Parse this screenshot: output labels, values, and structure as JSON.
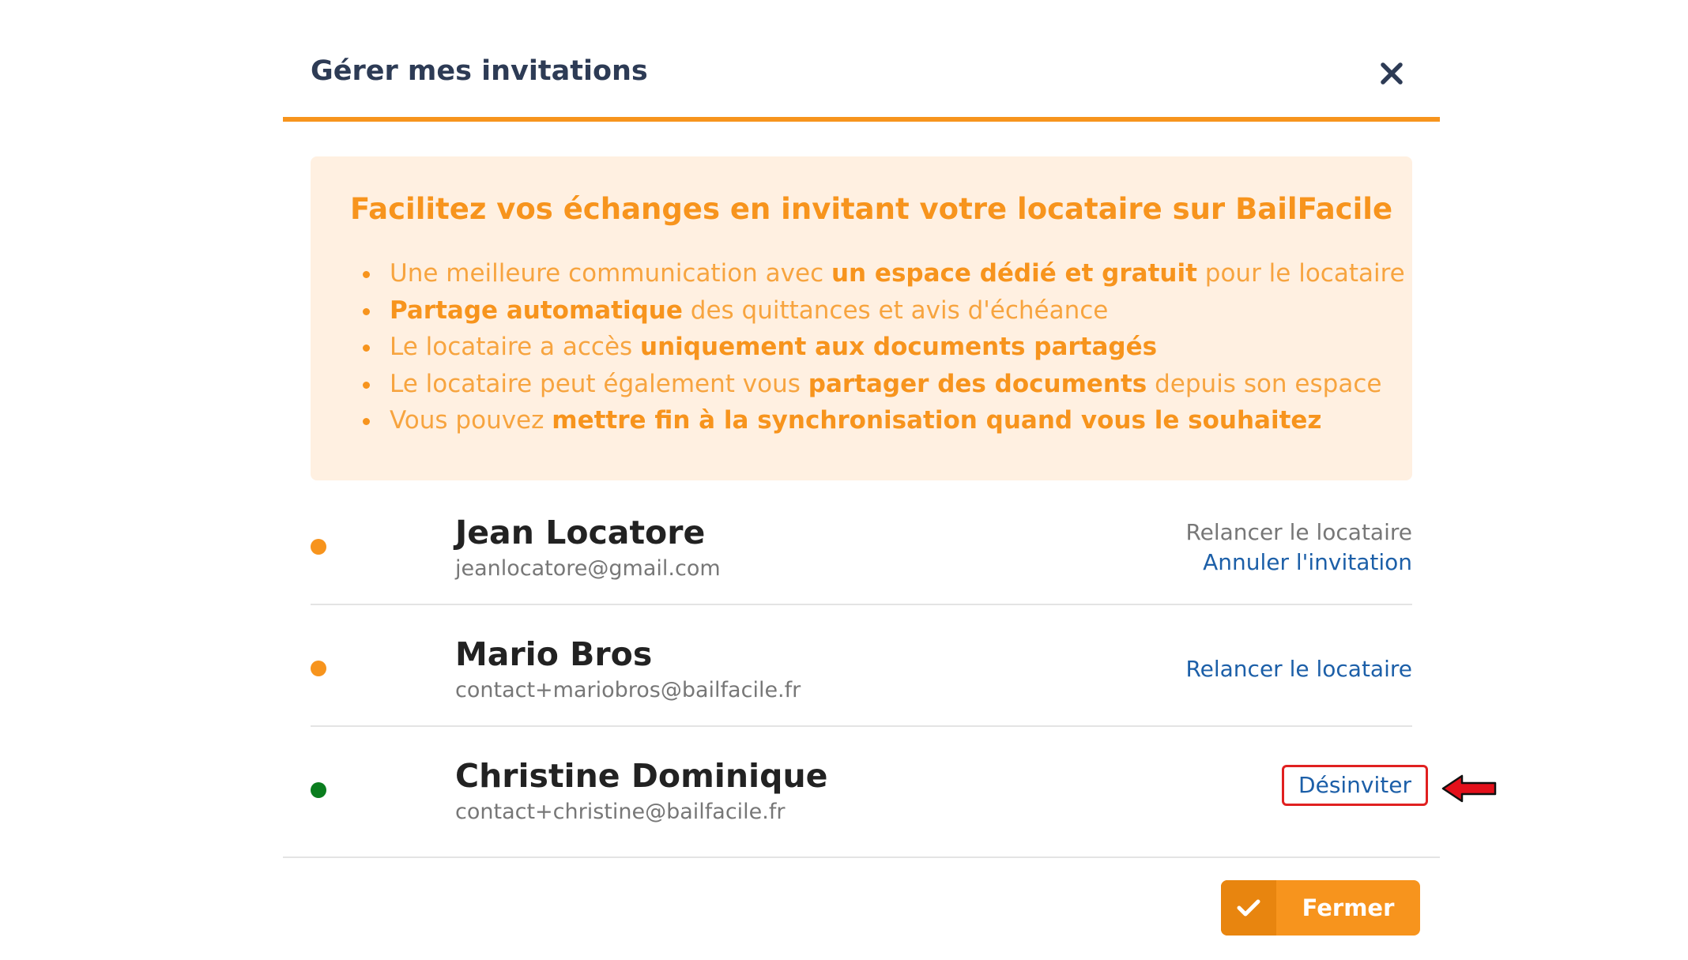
{
  "modal": {
    "title": "Gérer mes invitations",
    "close_icon": "close-icon"
  },
  "info": {
    "title": "Facilitez vos échanges en invitant votre locataire sur BailFacile",
    "items": [
      {
        "pre": "Une meilleure communication avec ",
        "bold": "un espace dédié et gratuit",
        "post": " pour le locataire"
      },
      {
        "pre": "",
        "bold": "Partage automatique",
        "post": " des quittances et avis d'échéance"
      },
      {
        "pre": "Le locataire a accès ",
        "bold": "uniquement aux documents partagés",
        "post": ""
      },
      {
        "pre": "Le locataire peut également vous ",
        "bold": "partager des documents",
        "post": " depuis son espace"
      },
      {
        "pre": "Vous pouvez ",
        "bold": "mettre fin à la synchronisation quand vous le souhaitez",
        "post": ""
      }
    ]
  },
  "invitations": [
    {
      "name": "Jean Locatore",
      "email": "jeanlocatore@gmail.com",
      "status_color": "#f7941d",
      "action1": "Relancer le locataire",
      "action2": "Annuler l'invitation"
    },
    {
      "name": "Mario Bros",
      "email": "contact+mariobros@bailfacile.fr",
      "status_color": "#f7941d",
      "action1": "Relancer le locataire"
    },
    {
      "name": "Christine Dominique",
      "email": "contact+christine@bailfacile.fr",
      "status_color": "#0a7d1e",
      "action1": "Désinviter"
    }
  ],
  "footer": {
    "close_label": "Fermer",
    "check_icon": "check-icon"
  },
  "colors": {
    "accent": "#f7941d",
    "link": "#1c5fa8",
    "highlight": "#e02020"
  }
}
